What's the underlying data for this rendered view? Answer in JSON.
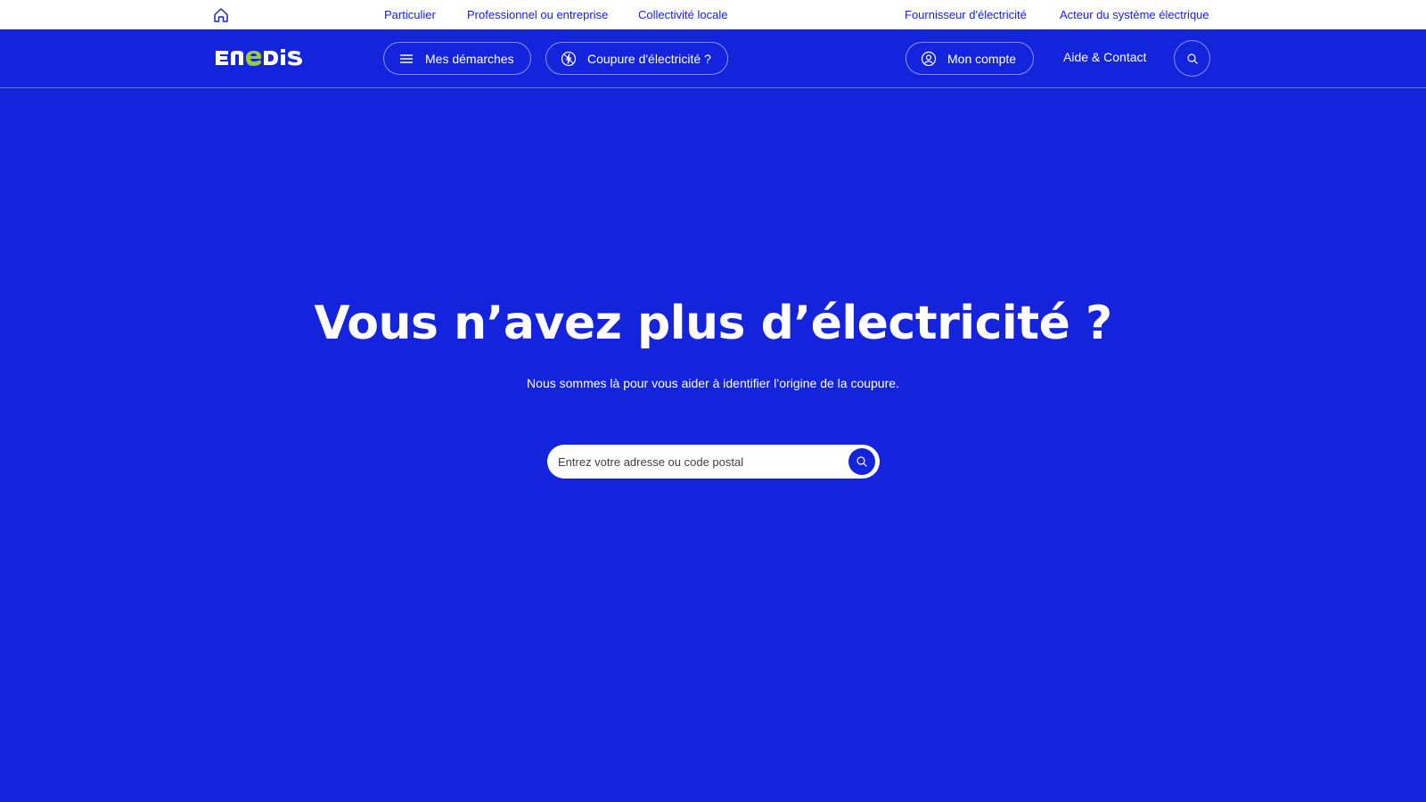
{
  "topbar": {
    "home_icon": "home-icon",
    "links": [
      "Particulier",
      "Professionnel ou entreprise",
      "Collectivité locale",
      "Fournisseur d'électricité",
      "Acteur du système électrique"
    ]
  },
  "header": {
    "logo_text": "ENEDIS",
    "menu_button": "Mes démarches",
    "outage_button": "Coupure d'électricité ?",
    "account_button": "Mon compte",
    "help_link": "Aide & Contact",
    "search_icon": "search-icon"
  },
  "hero": {
    "title": "Vous n’avez plus d’électricité ?",
    "subtitle": "Nous sommes là pour vous aider à identifier l’origine de la coupure.",
    "search_placeholder": "Entrez votre adresse ou code postal"
  },
  "colors": {
    "brand_blue": "#1423dc",
    "logo_green": "#96cd32",
    "white": "#ffffff"
  }
}
